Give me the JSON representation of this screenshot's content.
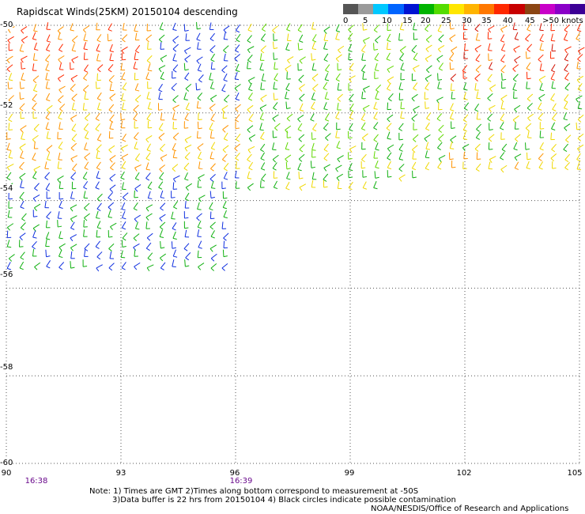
{
  "title": "Rapidscat Winds(25KM) 20150104 descending",
  "legend": {
    "colors": [
      "#555555",
      "#9a9a9a",
      "#00c8ff",
      "#0064ff",
      "#0014d2",
      "#00b400",
      "#54dc00",
      "#ffe600",
      "#ffb400",
      "#ff7800",
      "#ff2800",
      "#c80000",
      "#8b4513",
      "#c800c8",
      "#8a00c8",
      "#3c0096"
    ],
    "labels": [
      "0",
      "5",
      "10",
      "15",
      "20",
      "25",
      "30",
      "35",
      "40",
      "45",
      ">50 knots"
    ]
  },
  "axes": {
    "x_ticks": [
      "90",
      "93",
      "96",
      "99",
      "102",
      "105"
    ],
    "y_ticks": [
      "-50",
      "-52",
      "-54",
      "-56",
      "-58",
      "-60"
    ]
  },
  "times": [
    "16:38",
    "16:39"
  ],
  "notes": [
    "Note: 1) Times are GMT 2)Times along bottom correspond to measurement at -50S",
    "3)Data buffer is 22 hrs from 20150104 4) Black circles indicate possible contamination"
  ],
  "credit": "NOAA/NESDIS/Office of Research and Applications",
  "chart_data": {
    "type": "wind-barb-map",
    "title": "Rapidscat Winds(25KM) 20150104 descending",
    "x_range": [
      90,
      105
    ],
    "y_range": [
      -60,
      -50
    ],
    "units": "knots",
    "coverage": [
      {
        "region": "north swath (-50 to about -54)",
        "lon_range": [
          90,
          105
        ],
        "dominant_speed_knots": "15-35"
      },
      {
        "region": "western extension to -56",
        "lon_range": [
          90,
          96
        ],
        "dominant_speed_knots": "10-20"
      }
    ]
  }
}
